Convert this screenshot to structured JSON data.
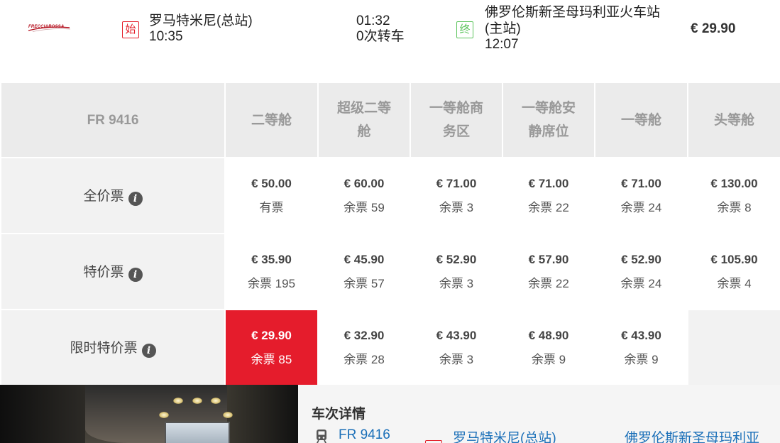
{
  "summary": {
    "logo_text": "FRECCIAROSSA",
    "start_badge": "始",
    "end_badge": "终",
    "origin_station": "罗马特米尼(总站)",
    "depart_time": "10:35",
    "duration": "01:32",
    "transfers": "0次转车",
    "dest_station_line1": "佛罗伦斯新圣母玛利亚火车站",
    "dest_station_line2": "(主站)",
    "arrive_time": "12:07",
    "price": "€ 29.90"
  },
  "fare_table": {
    "train_no": "FR 9416",
    "classes": [
      {
        "line1": "二等舱",
        "line2": ""
      },
      {
        "line1": "超级二等",
        "line2": "舱"
      },
      {
        "line1": "一等舱商",
        "line2": "务区"
      },
      {
        "line1": "一等舱安",
        "line2": "静席位"
      },
      {
        "line1": "一等舱",
        "line2": ""
      },
      {
        "line1": "头等舱",
        "line2": ""
      }
    ],
    "rows": [
      {
        "label": "全价票",
        "cells": [
          {
            "price": "€ 50.00",
            "left": "有票"
          },
          {
            "price": "€ 60.00",
            "left": "余票 59"
          },
          {
            "price": "€ 71.00",
            "left": "余票 3"
          },
          {
            "price": "€ 71.00",
            "left": "余票 22"
          },
          {
            "price": "€ 71.00",
            "left": "余票 24"
          },
          {
            "price": "€ 130.00",
            "left": "余票 8"
          }
        ]
      },
      {
        "label": "特价票",
        "cells": [
          {
            "price": "€ 35.90",
            "left": "余票 195"
          },
          {
            "price": "€ 45.90",
            "left": "余票 57"
          },
          {
            "price": "€ 52.90",
            "left": "余票 3"
          },
          {
            "price": "€ 57.90",
            "left": "余票 22"
          },
          {
            "price": "€ 52.90",
            "left": "余票 24"
          },
          {
            "price": "€ 105.90",
            "left": "余票 4"
          }
        ]
      },
      {
        "label": "限时特价票",
        "cells": [
          {
            "price": "€ 29.90",
            "left": "余票 85"
          },
          {
            "price": "€ 32.90",
            "left": "余票 28"
          },
          {
            "price": "€ 43.90",
            "left": "余票 3"
          },
          {
            "price": "€ 48.90",
            "left": "余票 9"
          },
          {
            "price": "€ 43.90",
            "left": "余票 9"
          },
          {
            "price": "",
            "left": ""
          }
        ]
      }
    ],
    "selected_color": "#e51c2c"
  },
  "details": {
    "title": "车次详情",
    "train_icon": "train-icon",
    "train_link": "FR 9416",
    "origin_link": "罗马特米尼(总站)",
    "dest_link": "佛罗伦斯新圣母玛利亚"
  }
}
